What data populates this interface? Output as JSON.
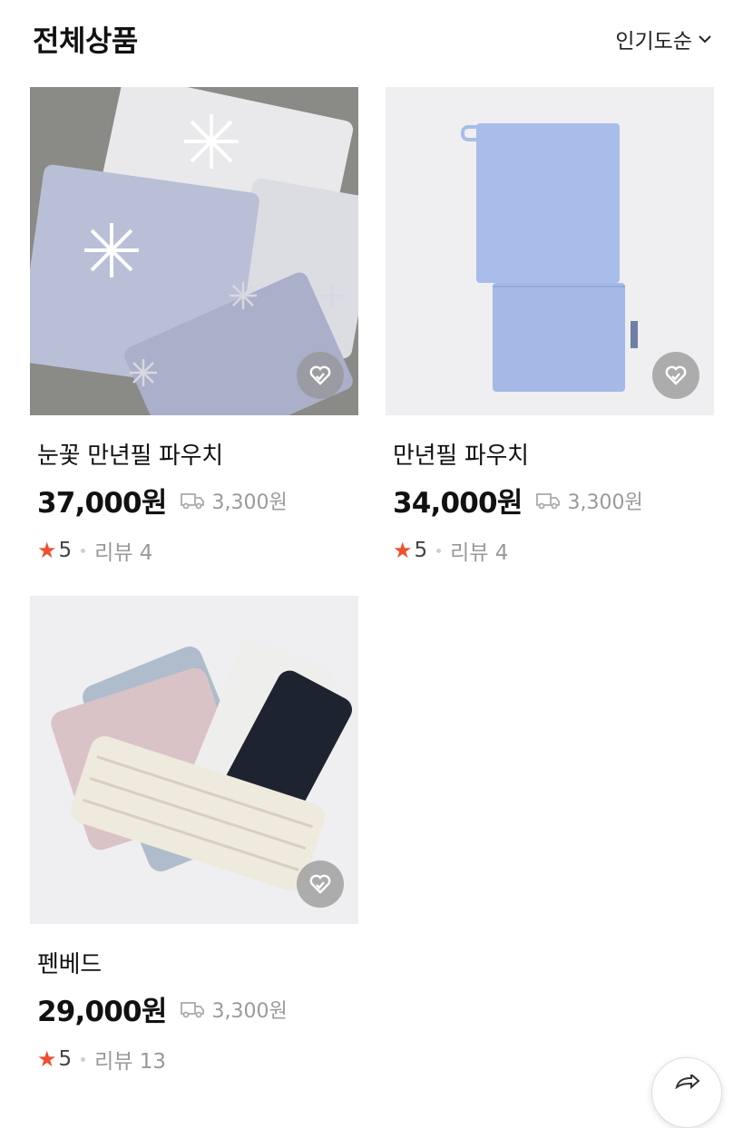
{
  "header": {
    "title": "전체상품",
    "sort_label": "인기도순"
  },
  "products": [
    {
      "name": "눈꽃 만년필 파우치",
      "price": "37,000원",
      "shipping": "3,300원",
      "rating": "5",
      "reviews": "리뷰 4"
    },
    {
      "name": "만년필 파우치",
      "price": "34,000원",
      "shipping": "3,300원",
      "rating": "5",
      "reviews": "리뷰 4"
    },
    {
      "name": "펜베드",
      "price": "29,000원",
      "shipping": "3,300원",
      "rating": "5",
      "reviews": "리뷰 13"
    }
  ],
  "icons": {
    "sort": "chevron-down-icon",
    "wishlist": "heart-check-icon",
    "shipping": "truck-icon",
    "star": "star-icon",
    "share": "share-icon"
  },
  "colors": {
    "star": "#f04e30",
    "muted": "#9a9a9a",
    "wish_bg": "#969696"
  }
}
